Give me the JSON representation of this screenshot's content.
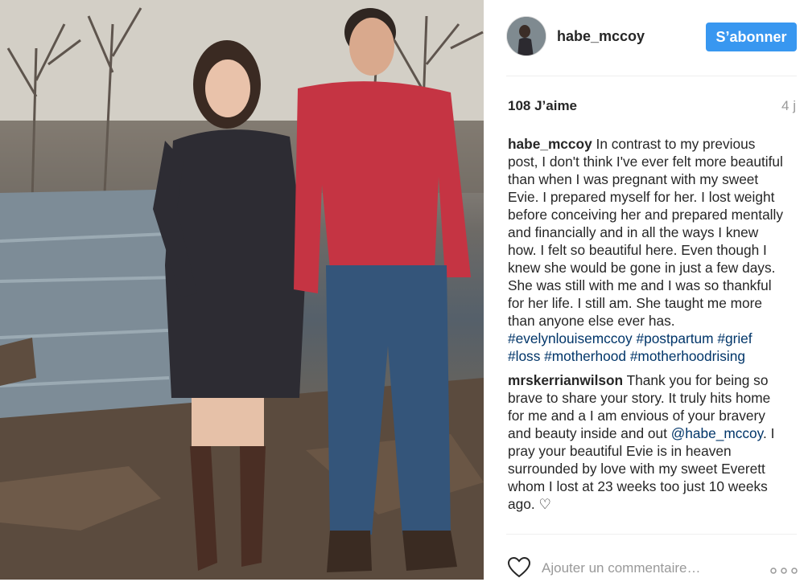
{
  "post": {
    "image_alt": "Couple standing on rocks by a river"
  },
  "header": {
    "username": "habe_mccoy",
    "follow_label": "S’abonner"
  },
  "stats": {
    "likes": "108 J’aime",
    "age": "4 j"
  },
  "caption": {
    "user": "habe_mccoy",
    "text": "In contrast to my previous post, I don't think I've ever felt more beautiful than when I was pregnant with my sweet Evie. I prepared myself for her. I lost weight before conceiving her and prepared mentally and financially and in all the ways I knew how. I felt so beautiful here. Even though I knew she would be gone in just a few days. She was still with me and I was so thankful for her life. I still am. She taught me more than anyone else ever has.",
    "hashtags": [
      "#evelynlouisemccoy",
      "#postpartum",
      "#grief",
      "#loss",
      "#motherhood",
      "#motherhoodrising"
    ]
  },
  "comment": {
    "user": "mrskerrianwilson",
    "text_before": "Thank you for being so brave to share your story. It truly hits home for me and a I am envious of your bravery and beauty inside and out",
    "mention": "@habe_mccoy",
    "text_after": ". I pray your beautiful Evie is in heaven surrounded by love with my sweet Everett whom I lost at 23 weeks too just 10 weeks ago. ♡"
  },
  "add_comment": {
    "placeholder": "Ajouter un commentaire…"
  },
  "icons": {
    "like": "heart-icon",
    "more": "more-options-icon"
  },
  "colors": {
    "accent": "#3897f0",
    "link": "#003569",
    "muted": "#999999"
  }
}
